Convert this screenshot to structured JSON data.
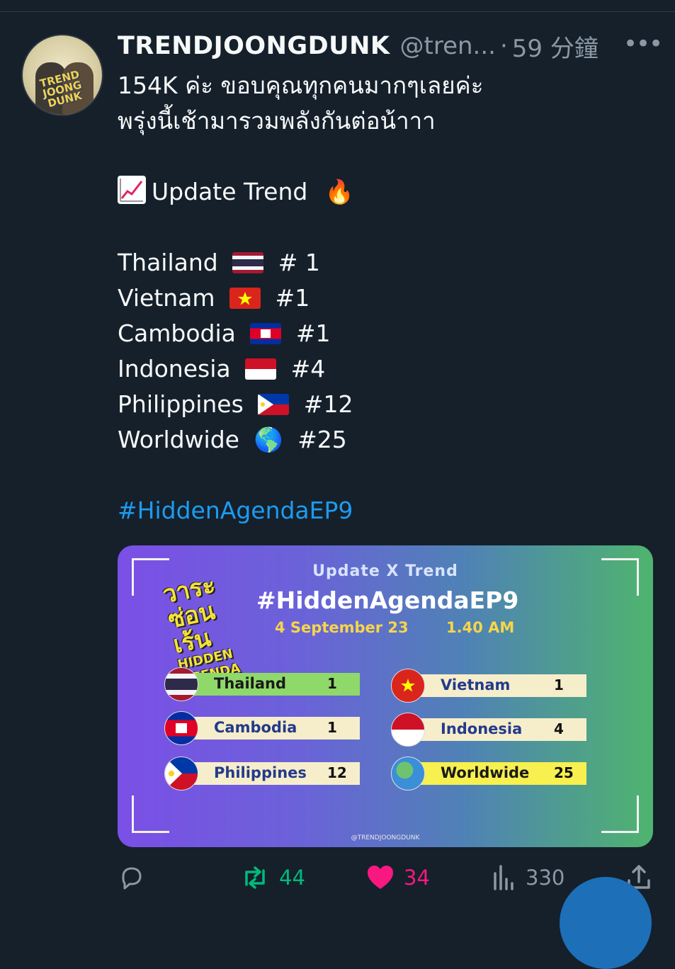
{
  "author": {
    "name": "TRENDJOONGDUNK",
    "handle": "@tren...",
    "separator": "·",
    "time": "59 分鐘",
    "avatar_text": "TREND JOONG DUNK"
  },
  "more_label": "•••",
  "tweet": {
    "line1": "154K ค่ะ  ขอบคุณทุกคนมากๆเลยค่ะ",
    "line2": "พรุ่งนี้เช้ามารวมพลังกันต่อน้าาา",
    "update_label": "Update Trend",
    "fire_emoji": "🔥",
    "trends": [
      {
        "country": "Thailand",
        "rank": "# 1"
      },
      {
        "country": "Vietnam",
        "rank": "#1"
      },
      {
        "country": "Cambodia",
        "rank": "#1"
      },
      {
        "country": "Indonesia",
        "rank": "#4"
      },
      {
        "country": "Philippines",
        "rank": "#12"
      },
      {
        "country": "Worldwide",
        "rank": "#25"
      }
    ],
    "globe_emoji": "🌎",
    "hashtag": "#HiddenAgendaEP9"
  },
  "card": {
    "subtitle": "Update  X Trend",
    "title": "#HiddenAgendaEP9",
    "date": "4 September  23",
    "time": "1.40 AM",
    "show_logo": "วาระ ซ่อนเร้น",
    "show_logo_small": "HIDDEN AGENDA",
    "rows": [
      {
        "country": "Thailand",
        "rank": "1"
      },
      {
        "country": "Vietnam",
        "rank": "1"
      },
      {
        "country": "Cambodia",
        "rank": "1"
      },
      {
        "country": "Indonesia",
        "rank": "4"
      },
      {
        "country": "Philippines",
        "rank": "12"
      },
      {
        "country": "Worldwide",
        "rank": "25"
      }
    ],
    "credit": "@TRENDJOONGDUNK"
  },
  "actions": {
    "retweets": "44",
    "likes": "34",
    "views": "330"
  },
  "colors": {
    "background": "#15202b",
    "link": "#1d9bf0",
    "retweet": "#00ba7c",
    "like": "#f91880",
    "muted": "#8b98a5"
  }
}
